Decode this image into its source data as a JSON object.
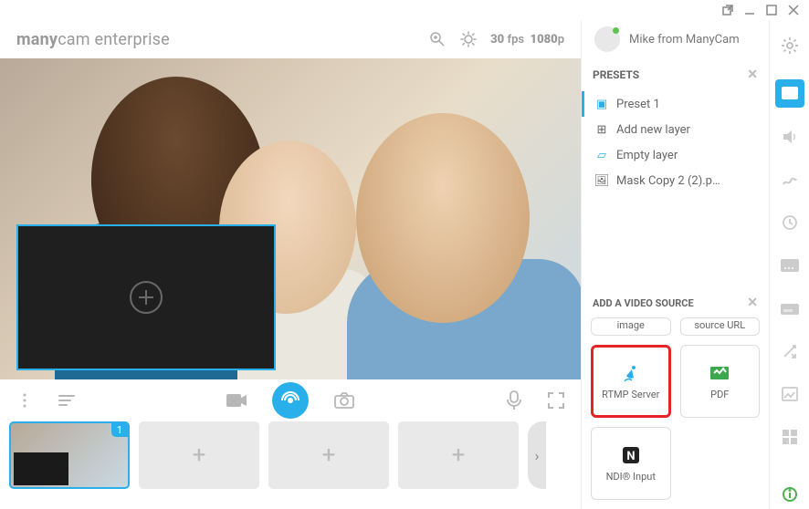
{
  "brand": {
    "bold": "many",
    "light": "cam",
    "suffix": " enterprise"
  },
  "header": {
    "fps": "30",
    "fps_unit": "fps",
    "res": "1080",
    "res_unit": "p"
  },
  "profile": {
    "name": "Mike from ManyCam"
  },
  "presets": {
    "title": "PRESETS",
    "items": [
      "Preset 1",
      "Add new layer",
      "Empty layer",
      "Mask Copy 2 (2).p…"
    ]
  },
  "source": {
    "title": "ADD A VIDEO SOURCE",
    "partial_top": [
      "image",
      "source URL"
    ],
    "tiles": [
      {
        "label": "RTMP Server",
        "highlight": true,
        "icon": "satellite"
      },
      {
        "label": "PDF",
        "icon": "pdf"
      },
      {
        "label": "NDI® Input",
        "icon": "ndi"
      }
    ]
  },
  "thumbs": {
    "badge": "1"
  }
}
